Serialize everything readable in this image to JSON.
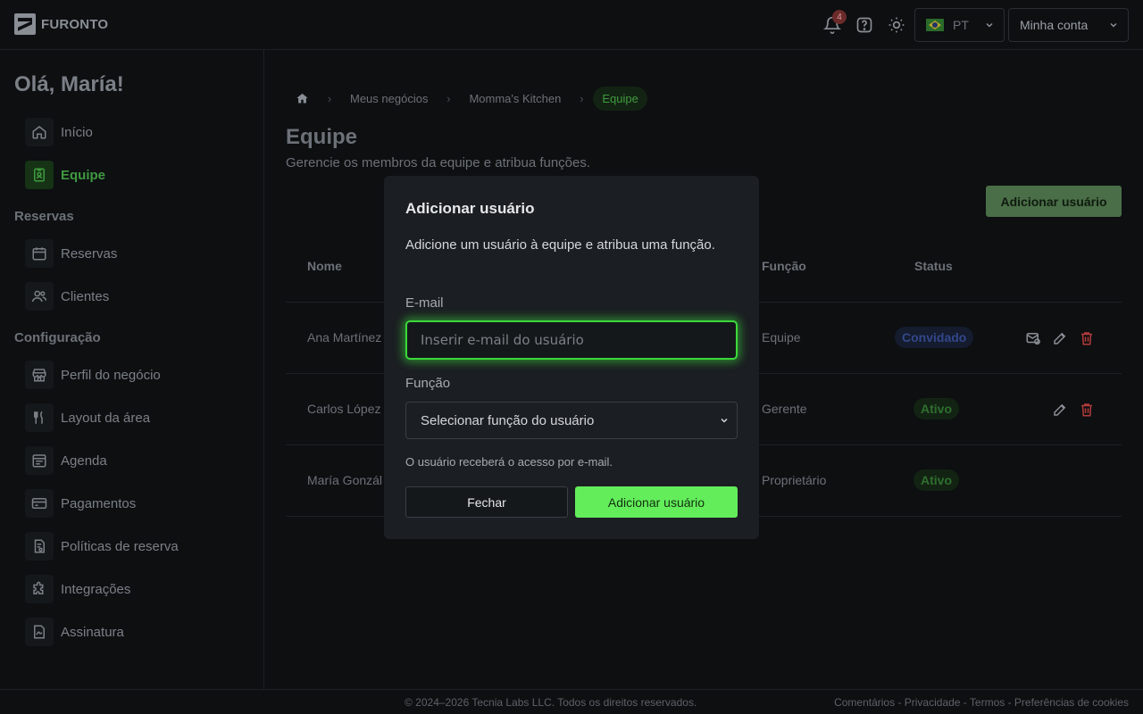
{
  "header": {
    "brand": "FURONTO",
    "notifications_count": "4",
    "language": "PT",
    "account_label": "Minha conta"
  },
  "sidebar": {
    "greeting": "Olá, María!",
    "items_top": [
      {
        "label": "Início",
        "icon": "home-icon"
      },
      {
        "label": "Equipe",
        "icon": "team-badge-icon",
        "active": true
      }
    ],
    "section_reservas": "Reservas",
    "items_reservas": [
      {
        "label": "Reservas",
        "icon": "calendar-icon"
      },
      {
        "label": "Clientes",
        "icon": "users-icon"
      }
    ],
    "section_config": "Configuração",
    "items_config": [
      {
        "label": "Perfil do negócio",
        "icon": "store-icon"
      },
      {
        "label": "Layout da área",
        "icon": "utensils-icon"
      },
      {
        "label": "Agenda",
        "icon": "schedule-icon"
      },
      {
        "label": "Pagamentos",
        "icon": "card-icon"
      },
      {
        "label": "Políticas de reserva",
        "icon": "policy-icon"
      },
      {
        "label": "Integrações",
        "icon": "puzzle-icon"
      },
      {
        "label": "Assinatura",
        "icon": "signature-icon"
      }
    ]
  },
  "breadcrumb": [
    "Meus negócios",
    "Momma's Kitchen",
    "Equipe"
  ],
  "page": {
    "title": "Equipe",
    "subtitle": "Gerencie os membros da equipe e atribua funções.",
    "add_button": "Adicionar usuário"
  },
  "table": {
    "headers": {
      "name": "Nome",
      "role": "Função",
      "status": "Status"
    },
    "rows": [
      {
        "name": "Ana Martínez",
        "role": "Equipe",
        "status": "Convidado"
      },
      {
        "name": "Carlos López",
        "role": "Gerente",
        "status": "Ativo"
      },
      {
        "name": "María Gonzál",
        "role": "Proprietário",
        "status": "Ativo"
      }
    ]
  },
  "modal": {
    "title": "Adicionar usuário",
    "description": "Adicione um usuário à equipe e atribua uma função.",
    "email_label": "E-mail",
    "email_placeholder": "Inserir e-mail do usuário",
    "role_label": "Função",
    "role_select": "Selecionar função do usuário",
    "hint": "O usuário receberá o acesso por e-mail.",
    "close_button": "Fechar",
    "add_button": "Adicionar usuário"
  },
  "footer": {
    "copyright": "© 2024–2026 Tecnia Labs LLC. Todos os direitos reservados.",
    "links": "Comentários - Privacidade - Termos - Preferências de cookies"
  },
  "colors": {
    "accent": "#63ed5b",
    "active_nav": "#3f9a3f",
    "invited": "#33478a",
    "danger": "#b33a3a"
  }
}
